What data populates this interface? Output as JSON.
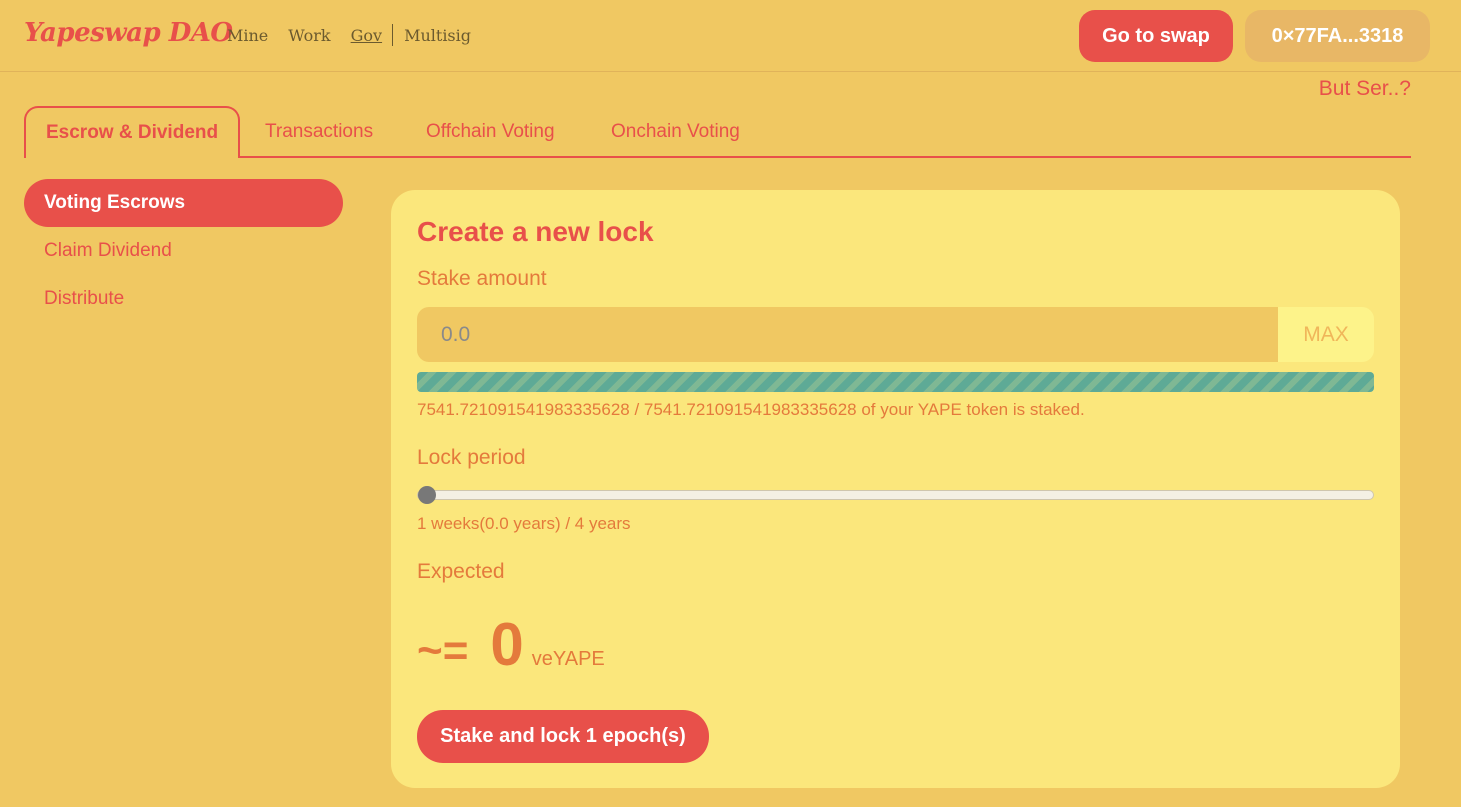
{
  "header": {
    "logo": "Yapeswap DAO",
    "nav": [
      "Mine",
      "Work",
      "Gov",
      "Multisig"
    ],
    "swap_label": "Go to swap",
    "wallet_label": "0×77FA...3318",
    "help_label": "But Ser..?"
  },
  "tabs": [
    "Escrow & Dividend",
    "Transactions",
    "Offchain Voting",
    "Onchain Voting"
  ],
  "sidebar": {
    "items": [
      "Voting Escrows",
      "Claim Dividend",
      "Distribute"
    ]
  },
  "card": {
    "title": "Create a new lock",
    "stake_label": "Stake amount",
    "stake_placeholder": "0.0",
    "max_label": "MAX",
    "staked_fraction": 1.0,
    "staked_text": "7541.721091541983335628 / 7541.721091541983335628 of your YAPE token is staked.",
    "lock_label": "Lock period",
    "lock_fraction": 0.0,
    "lock_text": "1 weeks(0.0 years) / 4 years",
    "expected_label": "Expected",
    "approx_symbol": "~=",
    "expected_value": "0",
    "expected_unit": "veYAPE",
    "submit_label": "Stake and lock 1 epoch(s)"
  }
}
